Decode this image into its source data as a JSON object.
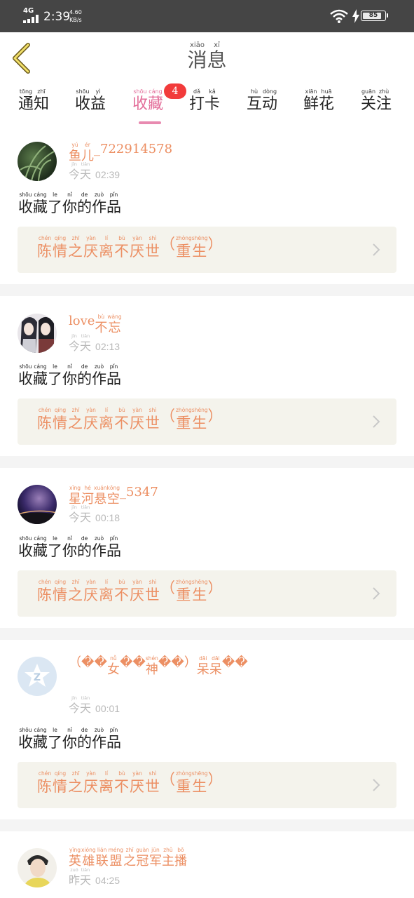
{
  "status_bar": {
    "network": "4G",
    "time": "2:39",
    "speed_value": "4.60",
    "speed_unit": "KB/s",
    "battery": "85"
  },
  "header": {
    "title": [
      {
        "c": "消",
        "p": "xiāo"
      },
      {
        "c": "息",
        "p": "xī"
      }
    ]
  },
  "tabs": [
    {
      "label": [
        {
          "c": "通",
          "p": "tōng"
        },
        {
          "c": "知",
          "p": "zhī"
        }
      ]
    },
    {
      "label": [
        {
          "c": "收",
          "p": "shōu"
        },
        {
          "c": "益",
          "p": "yì"
        }
      ]
    },
    {
      "label": [
        {
          "c": "收",
          "p": "shōu"
        },
        {
          "c": "藏",
          "p": "cáng"
        }
      ],
      "badge": "4",
      "active": true
    },
    {
      "label": [
        {
          "c": "打",
          "p": "dǎ"
        },
        {
          "c": "卡",
          "p": "kǎ"
        }
      ]
    },
    {
      "label": [
        {
          "c": "互",
          "p": "hù"
        },
        {
          "c": "动",
          "p": "dòng"
        }
      ]
    },
    {
      "label": [
        {
          "c": "鲜",
          "p": "xiān"
        },
        {
          "c": "花",
          "p": "huā"
        }
      ]
    },
    {
      "label": [
        {
          "c": "关",
          "p": "guān"
        },
        {
          "c": "注",
          "p": "zhù"
        }
      ]
    }
  ],
  "action_text": [
    {
      "c": "收",
      "p": "shōu"
    },
    {
      "c": "藏",
      "p": "cáng"
    },
    {
      "c": "了",
      "p": "le"
    },
    {
      "c": "你",
      "p": "nǐ"
    },
    {
      "c": "的",
      "p": "de"
    },
    {
      "c": "作",
      "p": "zuò"
    },
    {
      "c": "品",
      "p": "pǐn"
    }
  ],
  "work_title": [
    {
      "c": "陈",
      "p": "chén"
    },
    {
      "c": "情",
      "p": "qíng"
    },
    {
      "c": "之",
      "p": "zhī"
    },
    {
      "c": "厌",
      "p": "yàn"
    },
    {
      "c": "离",
      "p": "lí"
    },
    {
      "c": "不",
      "p": "bù"
    },
    {
      "c": "厌",
      "p": "yàn"
    },
    {
      "c": "世",
      "p": "shì"
    },
    {
      "c": "（",
      "p": ""
    },
    {
      "c": "重",
      "p": "zhòng"
    },
    {
      "c": "生",
      "p": "shēng"
    },
    {
      "c": "）",
      "p": ""
    }
  ],
  "notifications": [
    {
      "avatar_icon": "grass-photo-avatar",
      "username": [
        {
          "c": "鱼",
          "p": "yú"
        },
        {
          "c": "儿",
          "p": "ér"
        },
        {
          "c": "_722914578",
          "p": ""
        }
      ],
      "day": [
        {
          "c": "今",
          "p": "jīn"
        },
        {
          "c": "天",
          "p": "tiān"
        }
      ],
      "clock": "02:39",
      "has_action": true
    },
    {
      "avatar_icon": "anime-couple-avatar",
      "username": [
        {
          "c": "love",
          "p": ""
        },
        {
          "c": "不",
          "p": "bù"
        },
        {
          "c": "忘",
          "p": "wàng"
        }
      ],
      "day": [
        {
          "c": "今",
          "p": "jīn"
        },
        {
          "c": "天",
          "p": "tiān"
        }
      ],
      "clock": "02:13",
      "has_action": true
    },
    {
      "avatar_icon": "galaxy-avatar",
      "username": [
        {
          "c": "星",
          "p": "xīng"
        },
        {
          "c": "河",
          "p": "hé"
        },
        {
          "c": "悬",
          "p": "xuán"
        },
        {
          "c": "空",
          "p": "kōng"
        },
        {
          "c": "_5347",
          "p": ""
        }
      ],
      "day": [
        {
          "c": "今",
          "p": "jīn"
        },
        {
          "c": "天",
          "p": "tiān"
        }
      ],
      "clock": "00:18",
      "has_action": true
    },
    {
      "avatar_icon": "default-z-avatar",
      "username": [
        {
          "c": "（",
          "p": ""
        },
        {
          "c": "�",
          "p": ""
        },
        {
          "c": "�",
          "p": ""
        },
        {
          "c": "女",
          "p": "nǚ"
        },
        {
          "c": "�",
          "p": ""
        },
        {
          "c": "�",
          "p": ""
        },
        {
          "c": "神",
          "p": "shén"
        },
        {
          "c": "�",
          "p": ""
        },
        {
          "c": "�",
          "p": ""
        },
        {
          "c": "）",
          "p": ""
        },
        {
          "c": "呆",
          "p": "dāi"
        },
        {
          "c": "呆",
          "p": "dāi"
        },
        {
          "c": "�",
          "p": ""
        },
        {
          "c": "�",
          "p": ""
        }
      ],
      "day": [
        {
          "c": "今",
          "p": "jīn"
        },
        {
          "c": "天",
          "p": "tiān"
        }
      ],
      "clock": "00:01",
      "has_action": true
    },
    {
      "avatar_icon": "boy-portrait-avatar",
      "username": [
        {
          "c": "英",
          "p": "yīng"
        },
        {
          "c": "雄",
          "p": "xióng"
        },
        {
          "c": "联",
          "p": "lián"
        },
        {
          "c": "盟",
          "p": "méng"
        },
        {
          "c": "之",
          "p": "zhī"
        },
        {
          "c": "冠",
          "p": "guàn"
        },
        {
          "c": "军",
          "p": "jūn"
        },
        {
          "c": "主",
          "p": "zhǔ"
        },
        {
          "c": "播",
          "p": "bō"
        }
      ],
      "day": [
        {
          "c": "昨",
          "p": "zuó"
        },
        {
          "c": "天",
          "p": "tiān"
        }
      ],
      "clock": "04:25",
      "has_action": false
    }
  ],
  "colors": {
    "accent_pink": "#e36d99",
    "name_orange": "#ec8f63",
    "badge_red": "#f23b3b"
  }
}
